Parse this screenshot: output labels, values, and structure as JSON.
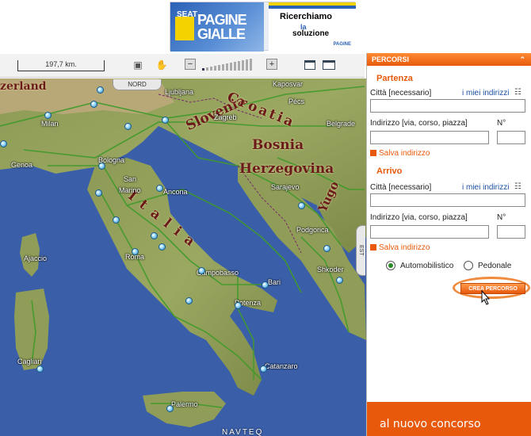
{
  "banner": {
    "seat_label": "SEAT",
    "pagine": "PAGINE",
    "gialle": "GIALLE",
    "tagline_line1": "Ricerchiamo",
    "tagline_line2": "la",
    "tagline_line3": "soluzione",
    "logo_small": "PAGINE"
  },
  "toolbar": {
    "scale_label": "197,7 km.",
    "zoom_out": "−",
    "zoom_in": "+"
  },
  "compass": {
    "north": "NORD",
    "east": "EST"
  },
  "map": {
    "regions": [
      "Slovenia",
      "Croatia",
      "Bosnia",
      "Herzegovina",
      "Italia",
      "Yugo",
      "zerland"
    ],
    "cities": [
      "Ljubljana",
      "Kaposvar",
      "Pécs",
      "Zagreb",
      "Belgrade",
      "Milan",
      "Genoa",
      "Bologna",
      "San",
      "Marino",
      "Ancona",
      "Sarajevo",
      "Ajaccio",
      "Roma",
      "Campobasso",
      "Bari",
      "Potenza",
      "Podgorica",
      "Tirana",
      "Shkoder",
      "Cagliari",
      "Catanzaro",
      "Palermo"
    ],
    "copyright": "NAVTEQ"
  },
  "panel": {
    "title": "PERCORSI",
    "collapse_icon": "chevron-up-icon",
    "partenza": "Partenza",
    "arrivo": "Arrivo",
    "citta_label": "Città [necessario]",
    "miei_indirizzi": "i miei indirizzi",
    "indirizzo_label": "Indirizzo [via, corso, piazza]",
    "numero_label": "N°",
    "salva": "Salva indirizzo",
    "automobilistico": "Automobilistico",
    "pedonale": "Pedonale",
    "crea": "CREA PERCORSO",
    "promo": "al nuovo concorso"
  }
}
